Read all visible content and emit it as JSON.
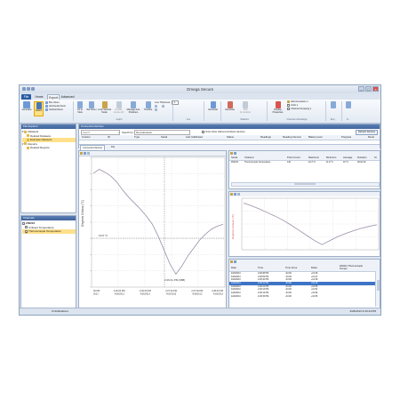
{
  "window": {
    "title": "Omega Secure"
  },
  "tabs": {
    "file": "File",
    "home": "Home",
    "export": "Export",
    "advanced": "Advanced"
  },
  "ribbon": {
    "generate": "Generate",
    "select": "Select",
    "box_zoom": "Box Zoom",
    "horizontal_zoom": "Horizontal Zoom",
    "vertical_zoom": "Vertical Zoom",
    "fit_to_view": "Fit to View",
    "set_zoom": "Set Zoom",
    "lock_vertical_scale": "Lock Vertical Scale",
    "enable_autoscroll": "Enable Autoscroll",
    "manage_axis_positions": "Manage Axis Positions",
    "timeline": "Timeline",
    "line_thickness_label": "Line Thickness:",
    "line_thickness_value": "1",
    "generate2": "Generate",
    "generate3": "Generate",
    "add_annotation_btn": "Add Annotation",
    "display_properties": "Display Properties",
    "add_annotation": "Add Annotation",
    "units": "Units",
    "channel_grouping": "Channel Grouping",
    "group_graph": "Graph",
    "group_line": "Line",
    "group_statistics": "Statistics",
    "group_channels": "Channels & Readings",
    "group_rep": "Rep...",
    "group_d": "D..."
  },
  "file_explorer": {
    "header": "File Explorer",
    "items": {
      "datasets": "Datasets",
      "deleted_datasets": "Deleted Datasets",
      "example_datasets": "Example Datasets",
      "reports": "Reports",
      "deleted_reports": "Deleted Reports"
    }
  },
  "channels": {
    "header": "Channels",
    "device": "Z00221",
    "ambient": "Ambient Temperature",
    "thermo": "Thermocouple Temperature"
  },
  "devices": {
    "header": "Connected devices",
    "search_placeholder": "Search",
    "search_by_label": "Search by:",
    "search_by_value": "No preference",
    "only_claimed": "Only show claimed wireless devices",
    "refresh": "Refresh Devices",
    "columns": [
      "Custom",
      "ID",
      "Type",
      "Serial",
      "Last Calibrated",
      "Status",
      "Readings",
      "Reading Interval",
      "Battery level",
      "Progress",
      "Revis"
    ]
  },
  "doc_tabs": {
    "connected": "Connected devices",
    "file": "File"
  },
  "chart_main": {
    "ylabel": "Degrees Celsius (°C)",
    "annotation_temp": "19.8 °C",
    "annotation_time": "2:26:41 PM (#88)"
  },
  "stats_panel": {
    "columns": [
      "Serial",
      "Channel",
      "Point Count",
      "Maximum",
      "Minimum",
      "Average",
      "Duration",
      "St"
    ],
    "row": [
      "Z00221",
      "Thermocouple Temperature",
      "140",
      "22.3 °C",
      "11.8 °C",
      "16 °C",
      "00:02:19"
    ]
  },
  "chart_small": {
    "ylabel": "Degrees Celsius (°C)"
  },
  "readings_panel": {
    "columns": [
      "Date",
      "Time",
      "Time Zone",
      "Delta",
      "Z00221 Thermocouple Temper"
    ],
    "rows": [
      [
        "4/26/2013",
        "2:28:08 PM",
        "-04:00",
        "+01:46"
      ],
      [
        "4/26/2013",
        "2:28:09 PM",
        "-04:00",
        "+01:47"
      ],
      [
        "4/26/2013",
        "2:28:10 PM",
        "-04:00",
        "+01:48"
      ],
      [
        "4/26/2013",
        "2:28:11 PM",
        "-04:00",
        "+01:49"
      ],
      [
        "4/26/2013",
        "2:28:12 PM",
        "-04:00",
        "+01:50"
      ],
      [
        "4/26/2013",
        "2:28:13 PM",
        "-04:00",
        "+01:51"
      ],
      [
        "4/26/2013",
        "2:28:14 PM",
        "-04:00",
        "+01:52"
      ],
      [
        "4/26/2013",
        "2:28:15 PM",
        "-04:00",
        "+01:53"
      ]
    ]
  },
  "statusbar": {
    "notifications": "0 Notifications",
    "datetime": "4/26/2013 2:33:44 PM"
  },
  "colors": {
    "accent": "#2c5da6",
    "highlight": "#ffe08a",
    "series": "#9b8fa8"
  },
  "chart_data": [
    {
      "type": "line",
      "ylabel": "Degrees Celsius (°C)",
      "x_ticks": [
        "30 PM\n2013",
        "2:26:00 PM\n4/26/2013",
        "2:26:30 PM\n4/26/2013",
        "2:27:00 PM\n4/26/2013",
        "2:27:30 PM\n4/26/2013",
        "2:28:00 PM\n4/26/2013"
      ],
      "y": [
        21.9,
        22.3,
        22.0,
        21.6,
        21.0,
        20.2,
        19.5,
        18.9,
        18.3,
        17.6,
        16.8,
        15.6,
        14.2,
        12.8,
        11.8,
        12.6,
        13.6,
        14.4,
        15.2,
        15.8,
        16.3,
        16.6,
        16.8
      ]
    },
    {
      "type": "line",
      "ylabel": "Degrees Celsius (°C)",
      "y": [
        22.3,
        21.6,
        20.8,
        19.9,
        19.0,
        18.0,
        16.8,
        15.5,
        14.2,
        12.9,
        11.8,
        12.8,
        13.8,
        14.6,
        15.3,
        15.9,
        16.4,
        16.8
      ]
    }
  ]
}
